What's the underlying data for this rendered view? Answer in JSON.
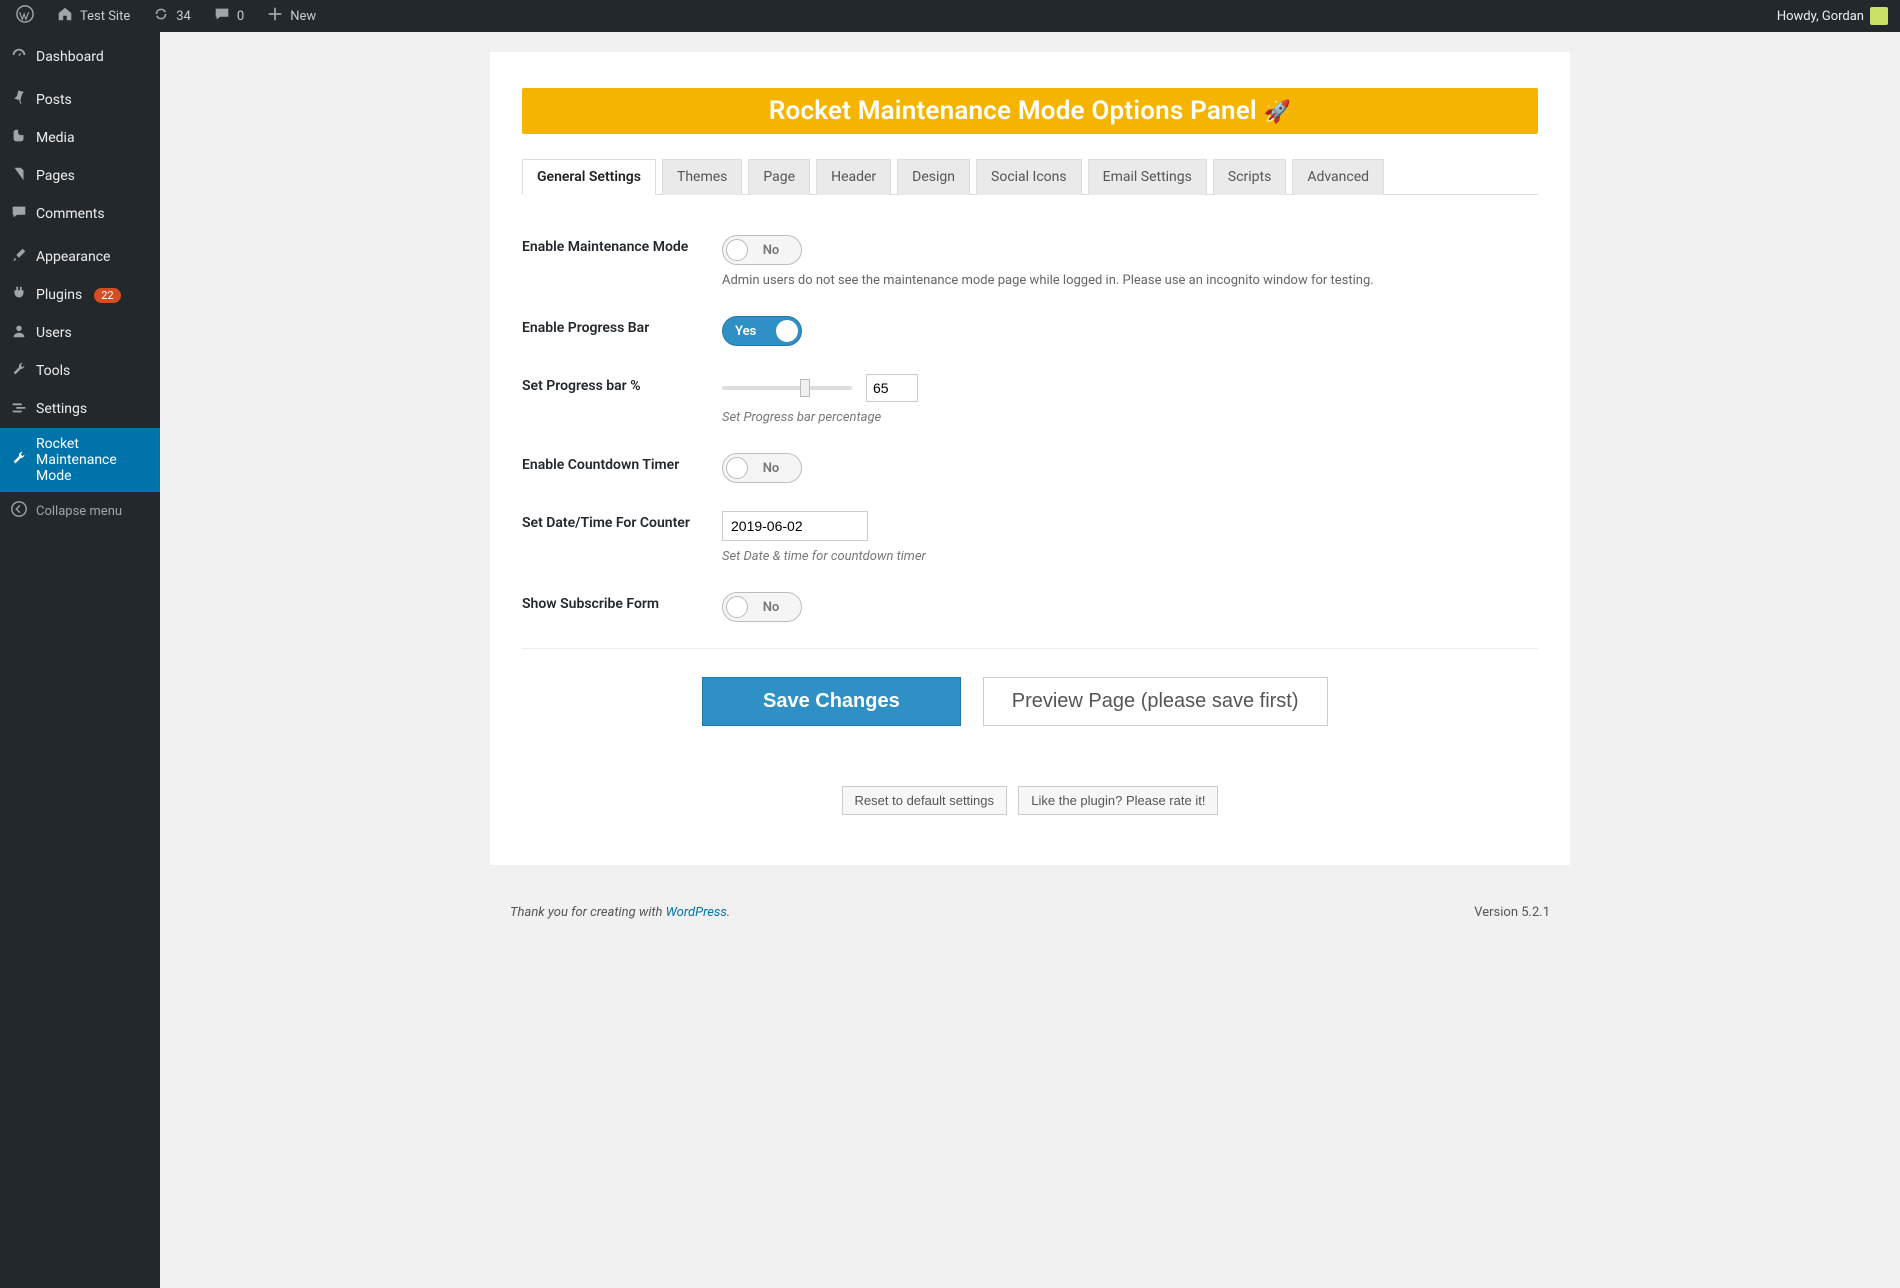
{
  "adminbar": {
    "site_name": "Test Site",
    "updates": "34",
    "comments": "0",
    "new": "New",
    "greeting": "Howdy, Gordan"
  },
  "sidebar": {
    "items": [
      {
        "label": "Dashboard"
      },
      {
        "label": "Posts"
      },
      {
        "label": "Media"
      },
      {
        "label": "Pages"
      },
      {
        "label": "Comments"
      },
      {
        "label": "Appearance"
      },
      {
        "label": "Plugins",
        "badge": "22"
      },
      {
        "label": "Users"
      },
      {
        "label": "Tools"
      },
      {
        "label": "Settings"
      },
      {
        "label": "Rocket Maintenance Mode"
      }
    ],
    "collapse": "Collapse menu"
  },
  "panel": {
    "title": "Rocket Maintenance Mode Options Panel",
    "tabs": [
      "General Settings",
      "Themes",
      "Page",
      "Header",
      "Design",
      "Social Icons",
      "Email Settings",
      "Scripts",
      "Advanced"
    ],
    "fields": {
      "enable_mm": {
        "label": "Enable Maintenance Mode",
        "value": "No",
        "desc": "Admin users do not see the maintenance mode page while logged in. Please use an incognito window for testing."
      },
      "enable_pb": {
        "label": "Enable Progress Bar",
        "value": "Yes"
      },
      "progress": {
        "label": "Set Progress bar %",
        "value": "65",
        "desc": "Set Progress bar percentage"
      },
      "enable_ct": {
        "label": "Enable Countdown Timer",
        "value": "No"
      },
      "datetime": {
        "label": "Set Date/Time For Counter",
        "value": "2019-06-02",
        "desc": "Set Date & time for countdown timer"
      },
      "subscribe": {
        "label": "Show Subscribe Form",
        "value": "No"
      }
    },
    "buttons": {
      "save": "Save Changes",
      "preview": "Preview Page (please save first)",
      "reset": "Reset to default settings",
      "rate": "Like the plugin? Please rate it!"
    }
  },
  "footer": {
    "thanks": "Thank you for creating with ",
    "wp": "WordPress",
    "dot": ".",
    "version": "Version 5.2.1"
  }
}
